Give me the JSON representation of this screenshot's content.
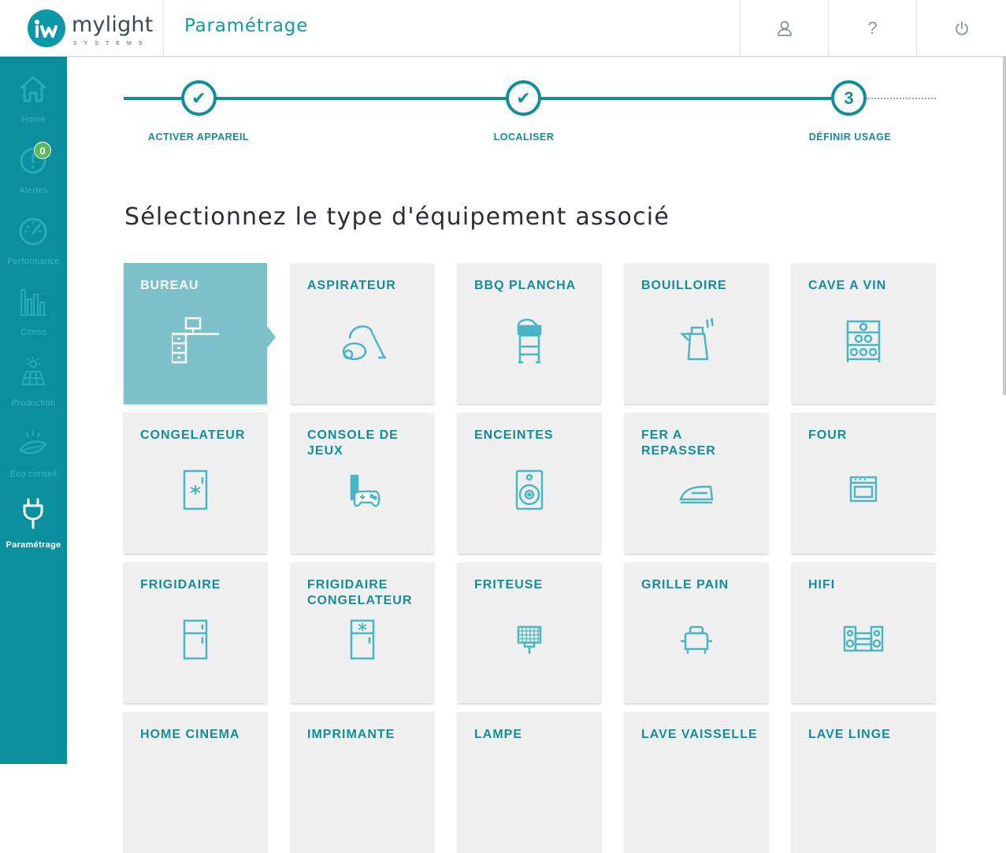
{
  "header": {
    "brand": "mylight",
    "brand_sub": "SYSTEMS",
    "title": "Paramétrage",
    "buttons": [
      {
        "name": "user-icon"
      },
      {
        "name": "help",
        "label": "?"
      },
      {
        "name": "power-icon"
      }
    ]
  },
  "sidebar": {
    "items": [
      {
        "label": "Home",
        "icon": "home-icon",
        "active": false
      },
      {
        "label": "Alertes",
        "icon": "alert-icon",
        "active": false,
        "badge": "0"
      },
      {
        "label": "Performance",
        "icon": "gauge-icon",
        "active": false
      },
      {
        "label": "Conso",
        "icon": "bar-chart-icon",
        "active": false
      },
      {
        "label": "Production",
        "icon": "solar-panel-icon",
        "active": false
      },
      {
        "label": "Eco conseil",
        "icon": "leaf-icon",
        "active": false
      },
      {
        "label": "Paramétrage",
        "icon": "plug-icon",
        "active": true
      }
    ]
  },
  "stepper": {
    "steps": [
      {
        "label": "ACTIVER APPAREIL",
        "state": "done",
        "mark": "✔"
      },
      {
        "label": "LOCALISER",
        "state": "done",
        "mark": "✔"
      },
      {
        "label": "DÉFINIR USAGE",
        "state": "current",
        "mark": "3"
      }
    ]
  },
  "main": {
    "heading": "Sélectionnez le type d'équipement associé",
    "tiles": [
      {
        "label": "BUREAU",
        "icon": "desk-icon",
        "selected": true
      },
      {
        "label": "ASPIRATEUR",
        "icon": "vacuum-icon",
        "selected": false
      },
      {
        "label": "BBQ PLANCHA",
        "icon": "bbq-icon",
        "selected": false
      },
      {
        "label": "BOUILLOIRE",
        "icon": "kettle-icon",
        "selected": false
      },
      {
        "label": "CAVE A VIN",
        "icon": "wine-cellar-icon",
        "selected": false
      },
      {
        "label": "CONGELATEUR",
        "icon": "freezer-icon",
        "selected": false
      },
      {
        "label": "CONSOLE DE JEUX",
        "icon": "game-console-icon",
        "selected": false
      },
      {
        "label": "ENCEINTES",
        "icon": "speaker-icon",
        "selected": false
      },
      {
        "label": "FER A REPASSER",
        "icon": "iron-icon",
        "selected": false
      },
      {
        "label": "FOUR",
        "icon": "oven-icon",
        "selected": false
      },
      {
        "label": "FRIGIDAIRE",
        "icon": "fridge-icon",
        "selected": false
      },
      {
        "label": "FRIGIDAIRE CONGELATEUR",
        "icon": "fridge-freezer-icon",
        "selected": false
      },
      {
        "label": "FRITEUSE",
        "icon": "fryer-icon",
        "selected": false
      },
      {
        "label": "GRILLE PAIN",
        "icon": "toaster-icon",
        "selected": false
      },
      {
        "label": "HIFI",
        "icon": "hifi-icon",
        "selected": false
      },
      {
        "label": "HOME CINEMA",
        "icon": "home-cinema-icon",
        "selected": false
      },
      {
        "label": "IMPRIMANTE",
        "icon": "printer-icon",
        "selected": false
      },
      {
        "label": "LAMPE",
        "icon": "lamp-icon",
        "selected": false
      },
      {
        "label": "LAVE VAISSELLE",
        "icon": "dishwasher-icon",
        "selected": false
      },
      {
        "label": "LAVE LINGE",
        "icon": "washing-machine-icon",
        "selected": false
      }
    ]
  },
  "colors": {
    "accent": "#138d9c",
    "sidebar": "#0a8f9e",
    "selected_tile": "#7cc0cb",
    "tile": "#f0f0f0"
  }
}
